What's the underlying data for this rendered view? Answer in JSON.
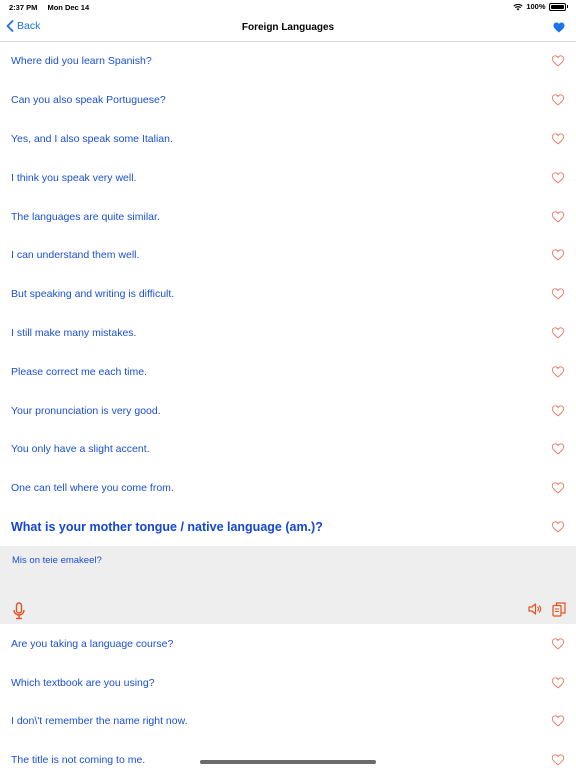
{
  "status": {
    "time": "2:37 PM",
    "date": "Mon Dec 14",
    "battery": "100%"
  },
  "nav": {
    "back_label": "Back",
    "title": "Foreign Languages"
  },
  "phrases_top": [
    "Where did you learn Spanish?",
    "Can you also speak Portuguese?",
    "Yes, and I also speak some Italian.",
    "I think you speak very well.",
    "The languages are quite similar.",
    "I can understand them well.",
    "But speaking and writing is difficult.",
    "I still make many mistakes.",
    "Please correct me each time.",
    "Your pronunciation is very good.",
    "You only have a slight accent.",
    "One can tell where you come from."
  ],
  "selected": {
    "phrase": "What is your mother tongue / native language (am.)?",
    "translation": "Mis on teie emakeel?"
  },
  "phrases_bottom": [
    "Are you taking a language course?",
    "Which textbook are you using?",
    "I don\\'t remember the name right now.",
    "The title is not coming to me."
  ],
  "icons": {
    "favorite_outline": "heart-outline-icon",
    "favorite_filled": "heart-filled-icon",
    "microphone": "microphone-icon",
    "speaker": "speaker-icon",
    "copy": "copy-icon"
  },
  "colors": {
    "accent": "#1a73e8",
    "text_link": "#1a4fd6",
    "heart": "#e8735f",
    "mic": "#e8501f",
    "expanded_bg": "#eeeeef"
  }
}
